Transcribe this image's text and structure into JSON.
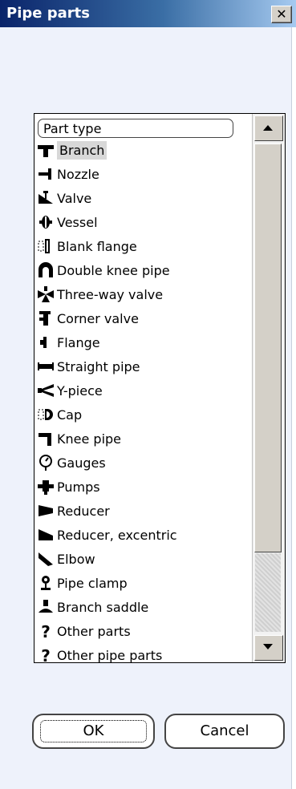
{
  "window": {
    "title": "Pipe parts",
    "close_label": "✕"
  },
  "list": {
    "header": "Part type",
    "selected_index": 0,
    "items": [
      {
        "label": "Branch",
        "icon": "branch-icon"
      },
      {
        "label": "Nozzle",
        "icon": "nozzle-icon"
      },
      {
        "label": "Valve",
        "icon": "valve-icon"
      },
      {
        "label": "Vessel",
        "icon": "vessel-icon"
      },
      {
        "label": "Blank flange",
        "icon": "blank-flange-icon"
      },
      {
        "label": "Double knee pipe",
        "icon": "double-knee-pipe-icon"
      },
      {
        "label": "Three-way valve",
        "icon": "three-way-valve-icon"
      },
      {
        "label": "Corner valve",
        "icon": "corner-valve-icon"
      },
      {
        "label": "Flange",
        "icon": "flange-icon"
      },
      {
        "label": "Straight pipe",
        "icon": "straight-pipe-icon"
      },
      {
        "label": "Y-piece",
        "icon": "y-piece-icon"
      },
      {
        "label": "Cap",
        "icon": "cap-icon"
      },
      {
        "label": "Knee pipe",
        "icon": "knee-pipe-icon"
      },
      {
        "label": "Gauges",
        "icon": "gauge-icon"
      },
      {
        "label": "Pumps",
        "icon": "pump-icon"
      },
      {
        "label": "Reducer",
        "icon": "reducer-icon"
      },
      {
        "label": "Reducer, excentric",
        "icon": "reducer-excentric-icon"
      },
      {
        "label": "Elbow",
        "icon": "elbow-icon"
      },
      {
        "label": "Pipe clamp",
        "icon": "pipe-clamp-icon"
      },
      {
        "label": "Branch saddle",
        "icon": "branch-saddle-icon"
      },
      {
        "label": "Other parts",
        "icon": "question-icon"
      },
      {
        "label": "Other pipe parts",
        "icon": "question-icon"
      }
    ]
  },
  "buttons": {
    "ok": "OK",
    "cancel": "Cancel"
  }
}
